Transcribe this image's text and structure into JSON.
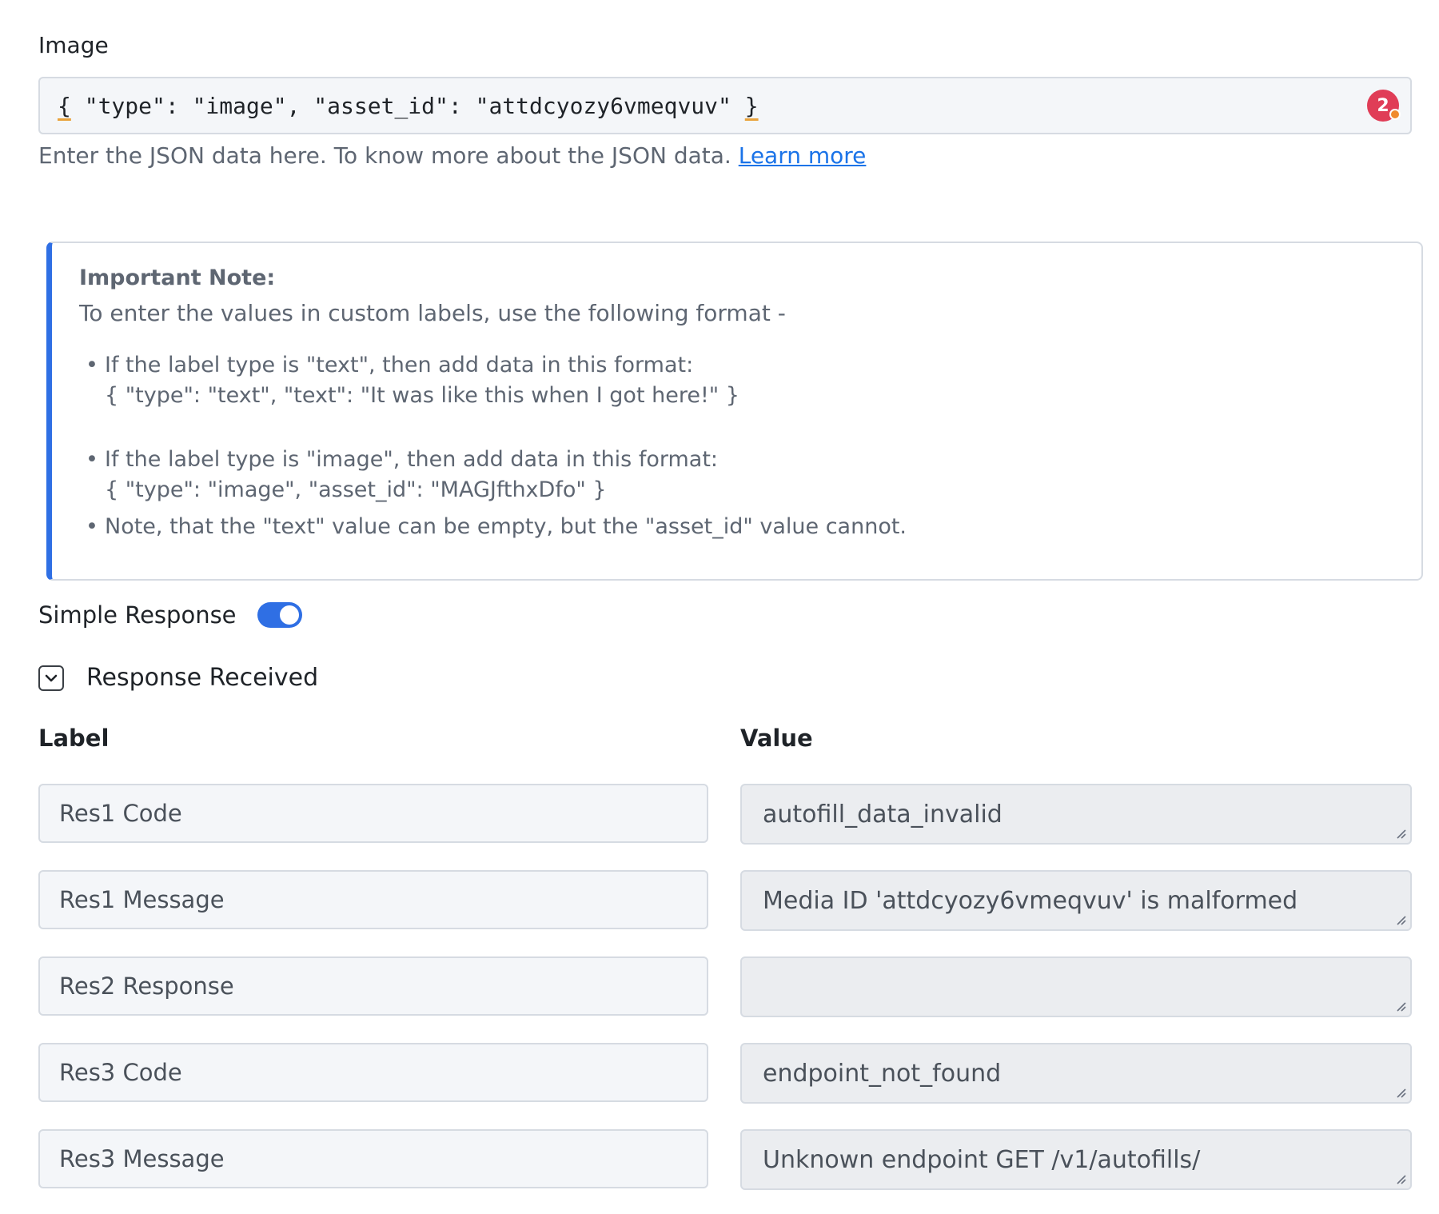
{
  "image_field": {
    "title": "Image",
    "value_open": "{",
    "value_body": " \"type\": \"image\", \"asset_id\": \"attdcyozy6vmeqvuv\" ",
    "value_close": "}",
    "badge_count": "2",
    "help_text": "Enter the JSON data here. To know more about the JSON data. ",
    "help_link": "Learn more"
  },
  "note": {
    "title": "Important Note:",
    "intro": "To enter the values in custom labels, use the following format -",
    "items": [
      {
        "line1": "If the label type is \"text\", then add data in this format:",
        "line2": "{ \"type\": \"text\", \"text\": \"It was like this when I got here!\" }"
      },
      {
        "line1": "If the label type is \"image\", then add data in this format:",
        "line2": "{ \"type\": \"image\", \"asset_id\": \"MAGJfthxDfo\" }"
      },
      {
        "line1": "Note, that the \"text\" value can be empty, but the \"asset_id\" value cannot."
      }
    ]
  },
  "simple_response": {
    "label": "Simple Response",
    "enabled": true,
    "accent": "#2f6fe4"
  },
  "response_received": {
    "label": "Response Received",
    "expanded": true
  },
  "table": {
    "label_header": "Label",
    "value_header": "Value",
    "rows": [
      {
        "label": "Res1 Code",
        "value": "autofill_data_invalid"
      },
      {
        "label": "Res1 Message",
        "value": "Media ID 'attdcyozy6vmeqvuv' is malformed"
      },
      {
        "label": "Res2 Response",
        "value": ""
      },
      {
        "label": "Res3 Code",
        "value": "endpoint_not_found"
      },
      {
        "label": "Res3 Message",
        "value": "Unknown endpoint GET /v1/autofills/"
      }
    ]
  }
}
